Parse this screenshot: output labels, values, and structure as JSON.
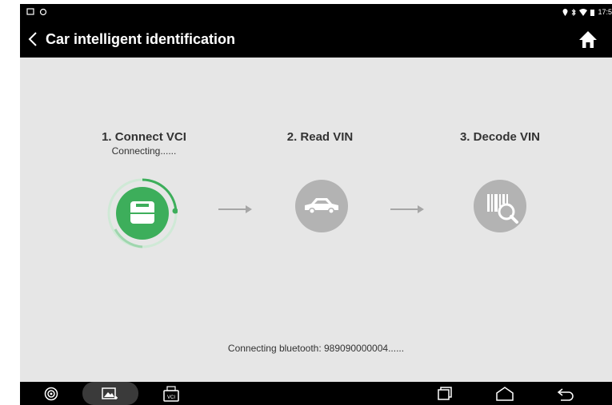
{
  "header": {
    "title": "Car intelligent identification"
  },
  "status_bar": {
    "time": "17:5"
  },
  "steps": [
    {
      "title": "1. Connect VCI",
      "subtitle": "Connecting......",
      "icon": "vci-device-icon",
      "color": "#3dae5b"
    },
    {
      "title": "2. Read VIN",
      "subtitle": "",
      "icon": "car-icon",
      "color": "#b3b3b3"
    },
    {
      "title": "3. Decode VIN",
      "subtitle": "",
      "icon": "barcode-search-icon",
      "color": "#b3b3b3"
    }
  ],
  "connection_status": "Connecting bluetooth: 989090000004......",
  "taskbar": {
    "vci_label": "VCI"
  }
}
